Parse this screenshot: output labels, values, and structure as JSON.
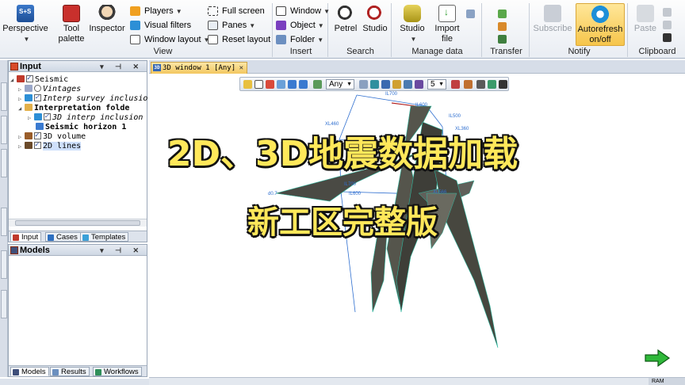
{
  "ribbon": {
    "perspective_label": "Perspective",
    "tool_palette_label": "Tool\npalette",
    "inspector_label": "Inspector",
    "players_label": "Players",
    "visual_filters_label": "Visual filters",
    "window_layout_label": "Window layout",
    "full_screen_label": "Full screen",
    "panes_label": "Panes",
    "reset_layout_label": "Reset layout",
    "view_group": "View",
    "window_label": "Window",
    "object_label": "Object",
    "folder_label": "Folder",
    "insert_group": "Insert",
    "petrel_label": "Petrel",
    "studio_search_label": "Studio",
    "search_group": "Search",
    "studio_label": "Studio",
    "import_file_label": "Import\nfile",
    "manage_data_group": "Manage data",
    "transfer_group": "Transfer",
    "subscribe_label": "Subscribe",
    "autorefresh_label": "Autorefresh\non/off",
    "notify_group": "Notify",
    "paste_label": "Paste",
    "clipboard_group": "Clipboard"
  },
  "input_pane": {
    "title": "Input",
    "tree": [
      {
        "label": "Seismic",
        "style": "normal"
      },
      {
        "label": "Vintages",
        "style": "italic"
      },
      {
        "label": "Interp survey inclusio",
        "style": "italic"
      },
      {
        "label": "Interpretation folde",
        "style": "bold"
      },
      {
        "label": "3D interp inclusion",
        "style": "italic"
      },
      {
        "label": "Seismic horizon 1",
        "style": "bold"
      },
      {
        "label": "3D volume",
        "style": "normal"
      },
      {
        "label": "2D lines",
        "style": "selected"
      }
    ],
    "tabs": [
      "Input",
      "Cases",
      "Templates"
    ]
  },
  "models_pane": {
    "title": "Models",
    "tabs": [
      "Models",
      "Results",
      "Workflows"
    ]
  },
  "window_tab": {
    "label": "3D window 1 [Any]",
    "badge": "3D"
  },
  "view_toolbar": {
    "domain_value": "Any",
    "z_scale_value": "5"
  },
  "seismic_labels": [
    "IL700",
    "IL600",
    "IL500",
    "XL460",
    "XL360",
    "IL700",
    "IL600",
    "XL566",
    "d0.7"
  ],
  "overlay": {
    "line1": "2D、3D地震数据加载",
    "line2": "新工区完整版"
  },
  "status": {
    "mode": "RAM"
  },
  "colors": {
    "overlay_text": "#ffe85a",
    "overlay_stroke": "#111111",
    "autorefresh_highlight": "#f6c54b",
    "window_tab": "#f3c760"
  }
}
